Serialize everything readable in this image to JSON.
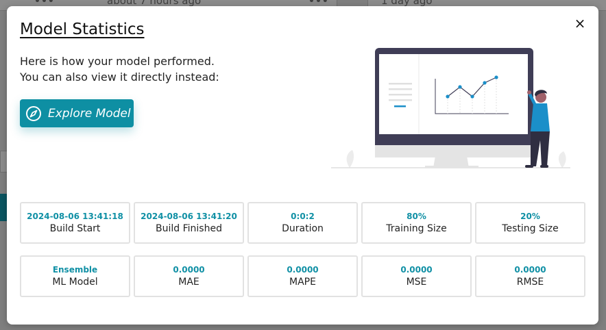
{
  "background": {
    "left_timestamp": "about 7 hours ago",
    "right_timestamp": "1 day ago"
  },
  "modal": {
    "title": "Model Statistics",
    "intro_line1": "Here is how your model performed.",
    "intro_line2": "You can also view it directly instead:",
    "explore_label": "Explore Model",
    "close_symbol": "×",
    "accent_color": "#0e8fa3"
  },
  "stats": [
    {
      "value": "2024-08-06 13:41:18",
      "label": "Build Start"
    },
    {
      "value": "2024-08-06 13:41:20",
      "label": "Build Finished"
    },
    {
      "value": "0:0:2",
      "label": "Duration"
    },
    {
      "value": "80%",
      "label": "Training Size"
    },
    {
      "value": "20%",
      "label": "Testing Size"
    },
    {
      "value": "Ensemble",
      "label": "ML Model"
    },
    {
      "value": "0.0000",
      "label": "MAE"
    },
    {
      "value": "0.0000",
      "label": "MAPE"
    },
    {
      "value": "0.0000",
      "label": "MSE"
    },
    {
      "value": "0.0000",
      "label": "RMSE"
    }
  ],
  "icons": {
    "close": "close-icon",
    "explore": "compass-icon",
    "illustration": "person-presenting-chart-illustration"
  }
}
